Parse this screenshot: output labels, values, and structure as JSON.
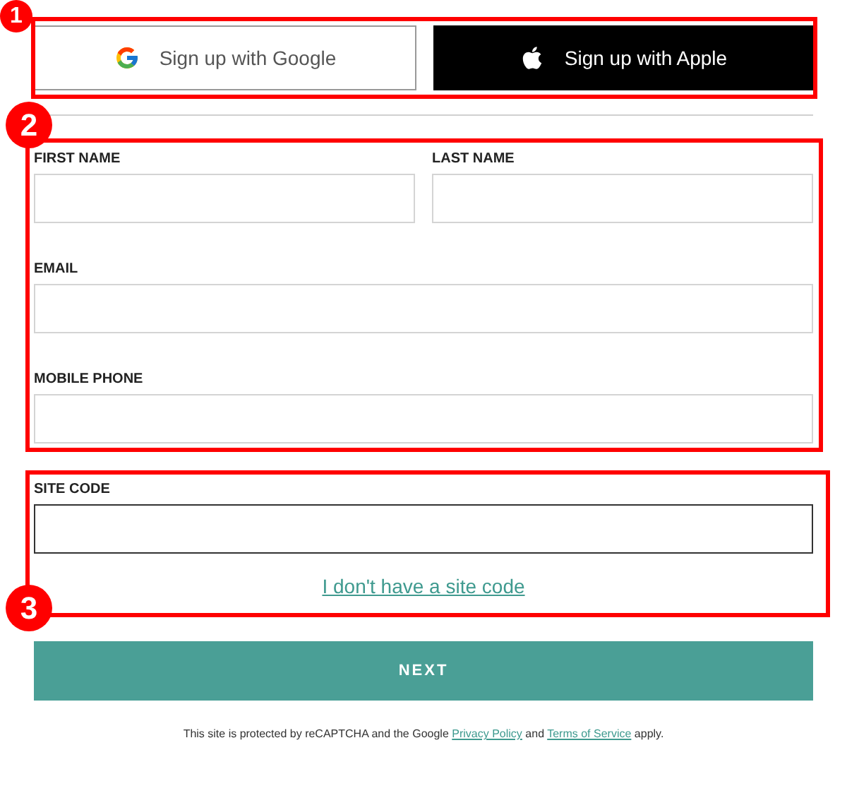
{
  "social_buttons": [
    {
      "kind": "google",
      "label": "Sign up with Google"
    },
    {
      "kind": "apple",
      "label": "Sign up with Apple"
    }
  ],
  "name_fields": [
    {
      "label": "FIRST NAME"
    },
    {
      "label": "LAST NAME"
    }
  ],
  "fields": [
    {
      "label": "EMAIL"
    },
    {
      "label": "MOBILE PHONE"
    }
  ],
  "site_code": {
    "label": "SITE CODE",
    "link": "I don't have a site code"
  },
  "next_button": "NEXT",
  "footer": {
    "before": "This site is protected by reCAPTCHA and the Google",
    "privacy_link": "Privacy Policy",
    "middle": "and",
    "terms_link": "Terms of Service",
    "after": "apply."
  },
  "annotations": [
    {
      "number": "1"
    },
    {
      "number": "2"
    },
    {
      "number": "3"
    }
  ]
}
